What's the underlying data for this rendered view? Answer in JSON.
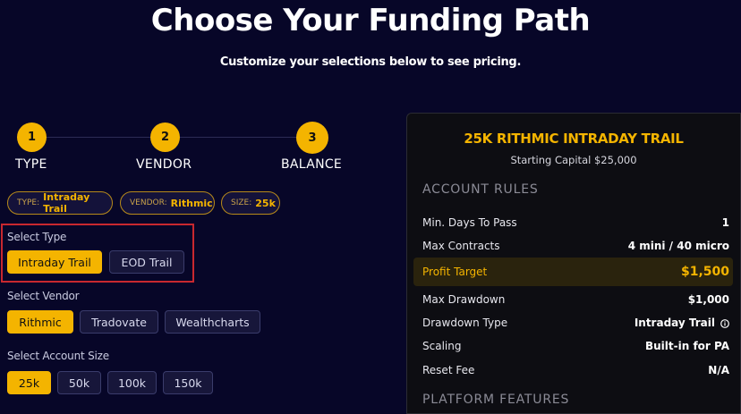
{
  "header": {
    "title": "Choose Your Funding Path",
    "subtitle": "Customize your selections below to see pricing."
  },
  "stepper": {
    "steps": [
      {
        "number": "1",
        "label": "TYPE"
      },
      {
        "number": "2",
        "label": "VENDOR"
      },
      {
        "number": "3",
        "label": "BALANCE"
      }
    ]
  },
  "summary_chips": [
    {
      "key": "TYPE:",
      "value": "Intraday Trail"
    },
    {
      "key": "VENDOR:",
      "value": "Rithmic"
    },
    {
      "key": "SIZE:",
      "value": "25k"
    }
  ],
  "select_type": {
    "label": "Select Type",
    "options": [
      "Intraday Trail",
      "EOD Trail"
    ],
    "selected": "Intraday Trail"
  },
  "select_vendor": {
    "label": "Select Vendor",
    "options": [
      "Rithmic",
      "Tradovate",
      "Wealthcharts"
    ],
    "selected": "Rithmic"
  },
  "select_size": {
    "label": "Select Account Size",
    "options": [
      "25k",
      "50k",
      "100k",
      "150k"
    ],
    "selected": "25k"
  },
  "panel": {
    "title": "25K RITHMIC INTRADAY TRAIL",
    "subtitle": "Starting Capital $25,000",
    "rules_heading": "ACCOUNT RULES",
    "rules": [
      {
        "label": "Min. Days To Pass",
        "value": "1"
      },
      {
        "label": "Max Contracts",
        "value": "4 mini / 40 micro"
      },
      {
        "label": "Profit Target",
        "value": "$1,500"
      },
      {
        "label": "Max Drawdown",
        "value": "$1,000"
      },
      {
        "label": "Drawdown Type",
        "value": "Intraday Trail"
      },
      {
        "label": "Scaling",
        "value": "Built-in for PA"
      },
      {
        "label": "Reset Fee",
        "value": "N/A"
      }
    ],
    "features_heading": "PLATFORM FEATURES"
  },
  "colors": {
    "background": "#070628",
    "accent": "#f4b400",
    "panel": "#0d0d12",
    "highlight_border": "#c8282f"
  }
}
